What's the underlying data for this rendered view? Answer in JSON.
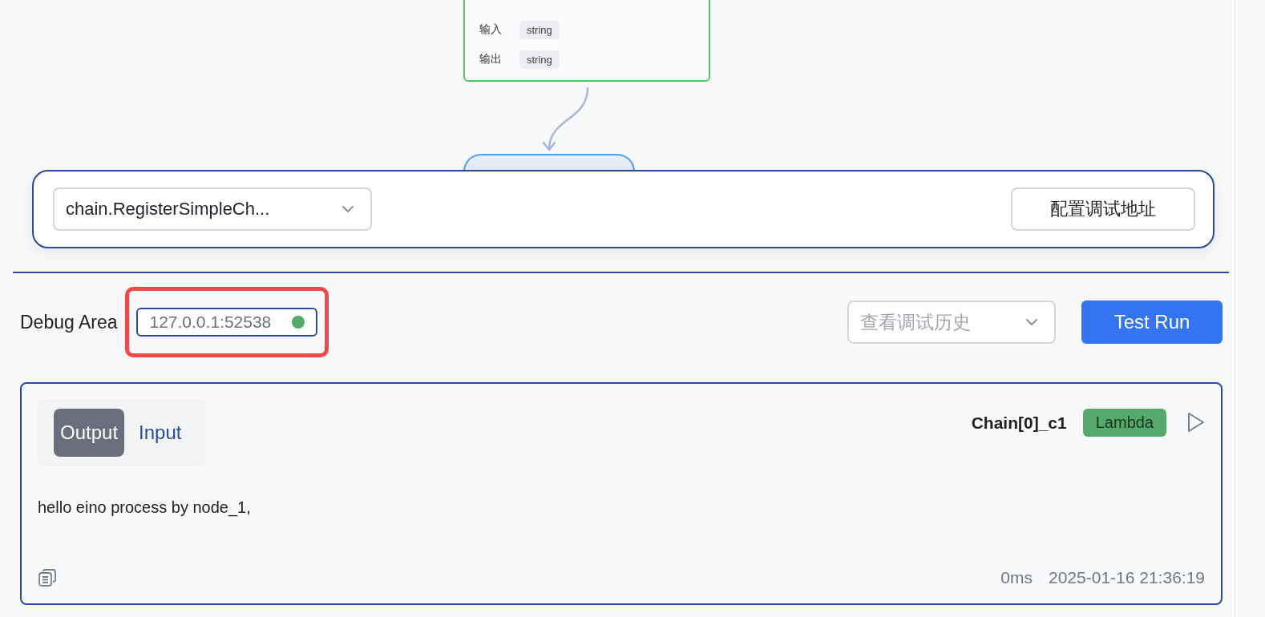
{
  "canvas": {
    "nodes": [
      {
        "kind": "detail",
        "fields": [
          {
            "label": "输入",
            "value": "string"
          },
          {
            "label": "输出",
            "value": "string"
          }
        ]
      },
      {
        "kind": "stub"
      }
    ]
  },
  "toolbar": {
    "chain_select": {
      "value": "chain.RegisterSimpleCh..."
    },
    "config_button": "配置调试地址"
  },
  "debug": {
    "title": "Debug Area",
    "address": "127.0.0.1:52538",
    "connected": true,
    "highlighted": true,
    "history_select": {
      "placeholder": "查看调试历史"
    },
    "run_button": "Test Run"
  },
  "result": {
    "tabs": [
      {
        "label": "Output",
        "selected": true
      },
      {
        "label": "Input",
        "selected": false
      }
    ],
    "node_name": "Chain[0]_c1",
    "node_type": "Lambda",
    "content": "hello eino process by node_1,",
    "duration": "0ms",
    "timestamp": "2025-01-16 21:36:19"
  }
}
